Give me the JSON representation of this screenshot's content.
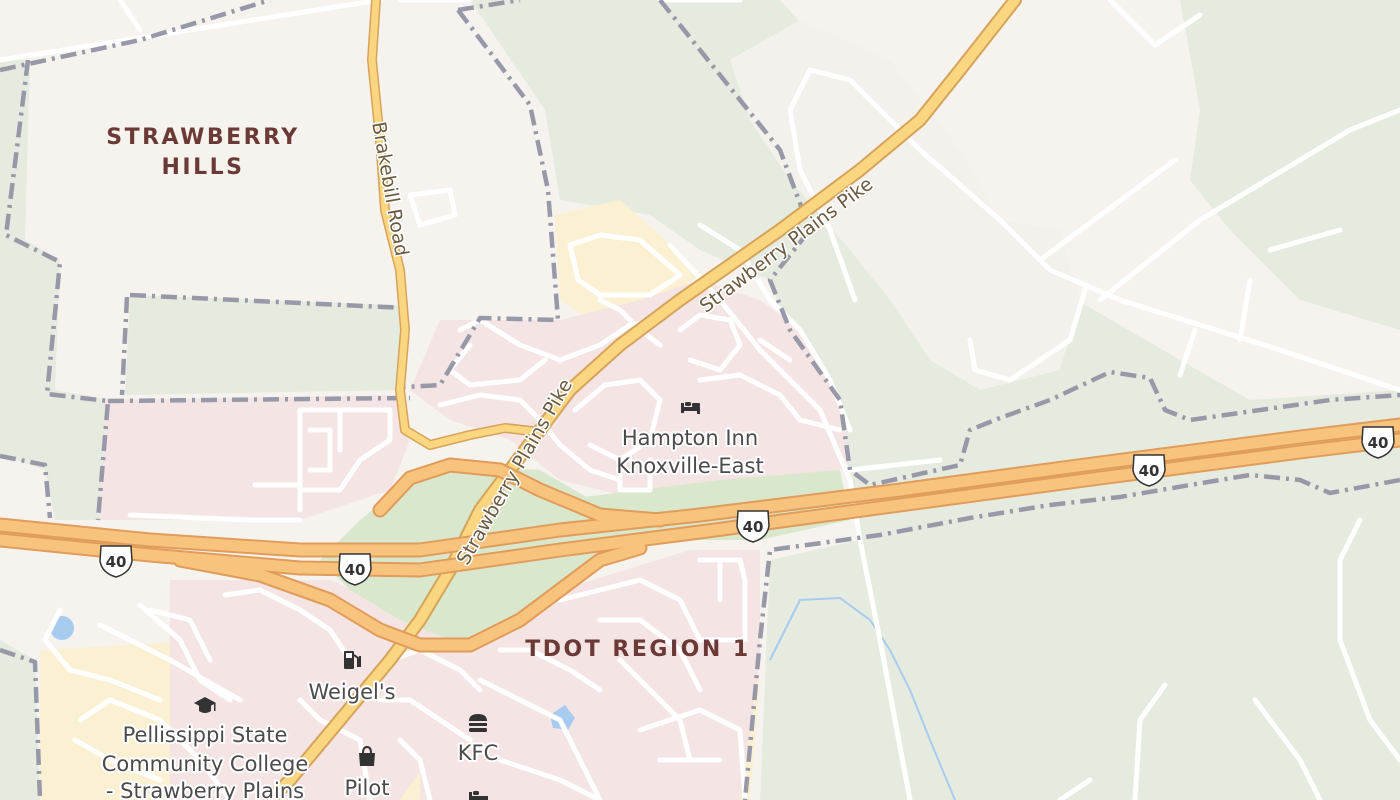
{
  "areas": {
    "strawberry_hills_line1": "STRAWBERRY",
    "strawberry_hills_line2": "HILLS",
    "tdot_region": "TDOT REGION 1"
  },
  "roads": {
    "brakebill": "Brakebill Road",
    "strawberry_plains_upper": "Strawberry Plains Pike",
    "strawberry_plains_middle": "Strawberry Plains Pike",
    "strawberry_plains_lower": "Strawberry Plains Pike"
  },
  "shields": {
    "interstate": "40"
  },
  "pois": {
    "hampton_line1": "Hampton Inn",
    "hampton_line2": "Knoxville-East",
    "weigels": "Weigel's",
    "kfc": "KFC",
    "pilot": "Pilot",
    "pellissippi_line1": "Pellissippi State",
    "pellissippi_line2": "Community College",
    "pellissippi_line3": "- Strawberry Plains"
  },
  "icons": {
    "hotel": "bed-icon",
    "fuel": "fuel-pump-icon",
    "fastfood": "burger-icon",
    "shop": "shopping-bag-icon",
    "college": "graduation-cap-icon"
  },
  "colors": {
    "background": "#f6f3ef",
    "forest": "#e6ebdf",
    "commercial": "#f5e4e4",
    "industrial": "#fbf1d2",
    "grass": "#d9e8cc",
    "motorway": "#f8c37d",
    "road": "#ffffff",
    "boundary": "#9899a8",
    "water": "#a8ccef"
  }
}
